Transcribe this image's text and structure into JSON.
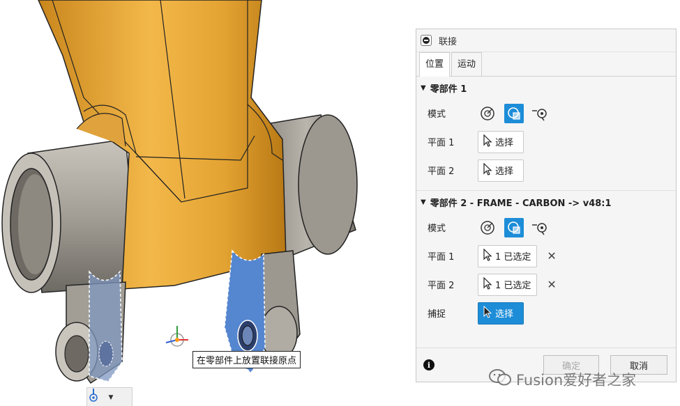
{
  "viewport": {
    "tooltip": "在零部件上放置联接原点",
    "colors": {
      "body": "#e7a533",
      "cylinder": "#9a958d",
      "selected_face": "#5586d0"
    },
    "snap_icon": "joint-origin-icon"
  },
  "dialog": {
    "title": "联接",
    "tabs": [
      "位置",
      "运动"
    ],
    "component1": {
      "header": "零部件 1",
      "mode_label": "模式",
      "plane1_label": "平面 1",
      "plane1_button": "选择",
      "plane2_label": "平面 2",
      "plane2_button": "选择"
    },
    "component2": {
      "header": "零部件 2 - FRAME - CARBON -> v48:1",
      "mode_label": "模式",
      "plane1_label": "平面 1",
      "plane1_button": "1 已选定",
      "plane2_label": "平面 2",
      "plane2_button": "1 已选定",
      "snap_label": "捕捉",
      "snap_button": "选择"
    },
    "ok_label": "确定",
    "cancel_label": "取消",
    "accent_color": "#1d8dd8"
  },
  "watermark": "Fusion爱好者之家"
}
